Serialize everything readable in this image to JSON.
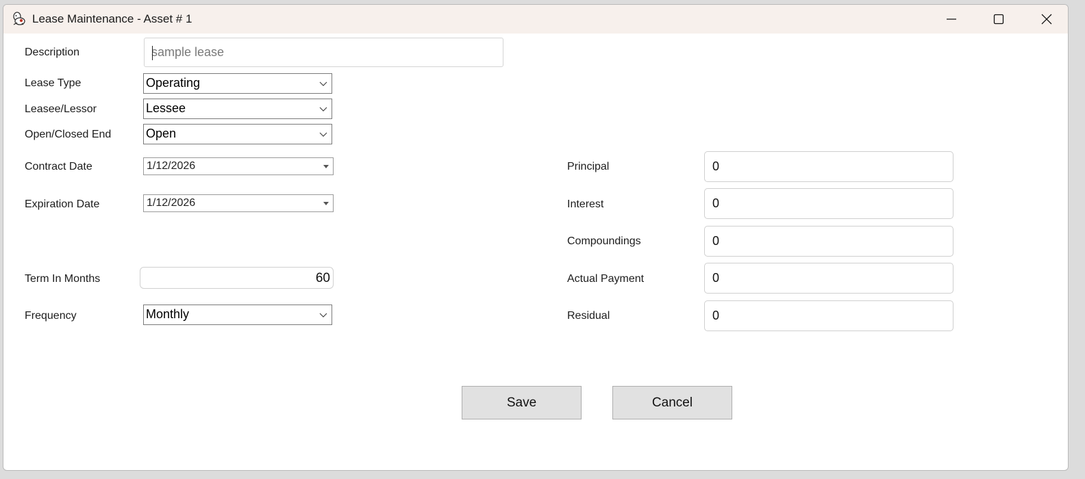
{
  "window": {
    "title": "Lease Maintenance - Asset # 1",
    "controls": {
      "minimize_icon": "minimize-icon",
      "maximize_icon": "maximize-icon",
      "close_icon": "close-icon"
    }
  },
  "form": {
    "description": {
      "label": "Description",
      "placeholder": "sample lease",
      "value": ""
    },
    "lease_type": {
      "label": "Lease Type",
      "value": "Operating"
    },
    "leasee_lessor": {
      "label": "Leasee/Lessor",
      "value": "Lessee"
    },
    "open_closed": {
      "label": "Open/Closed End",
      "value": "Open"
    },
    "contract_date": {
      "label": "Contract Date",
      "value": "1/12/2026"
    },
    "expiration_date": {
      "label": "Expiration Date",
      "value": "1/12/2026"
    },
    "term_months": {
      "label": "Term In Months",
      "value": "60"
    },
    "frequency": {
      "label": "Frequency",
      "value": "Monthly"
    },
    "principal": {
      "label": "Principal",
      "value": "0"
    },
    "interest": {
      "label": "Interest",
      "value": "0"
    },
    "compoundings": {
      "label": "Compoundings",
      "value": "0"
    },
    "actual_payment": {
      "label": "Actual Payment",
      "value": "0"
    },
    "residual": {
      "label": "Residual",
      "value": "0"
    }
  },
  "buttons": {
    "save": "Save",
    "cancel": "Cancel"
  },
  "colors": {
    "titlebar": "#f7f0ec",
    "button_bg": "#e1e1e1",
    "window_bg": "#ffffff"
  }
}
